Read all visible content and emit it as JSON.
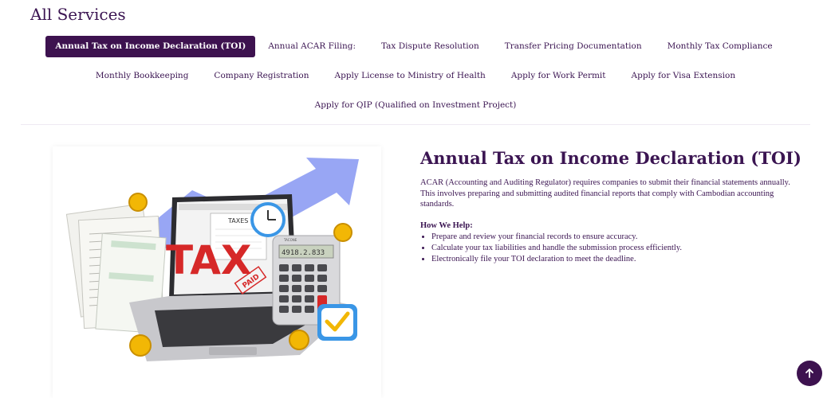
{
  "page": {
    "title": "All Services"
  },
  "tabs": {
    "row1": [
      {
        "label": "Annual Tax on Income Declaration (TOI)",
        "active": true
      },
      {
        "label": "Annual ACAR Filing:"
      },
      {
        "label": "Tax Dispute Resolution"
      },
      {
        "label": "Transfer Pricing Documentation"
      },
      {
        "label": "Monthly Tax Compliance"
      }
    ],
    "row2": [
      {
        "label": "Monthly Bookkeeping"
      },
      {
        "label": "Company Registration"
      },
      {
        "label": "Apply License to Ministry of Health"
      },
      {
        "label": "Apply for Work Permit"
      },
      {
        "label": "Apply for Visa Extension"
      }
    ],
    "row3": [
      {
        "label": "Apply for QIP (Qualified on Investment Project)"
      }
    ]
  },
  "illustration": {
    "tax_text": "TAX",
    "taxes_label": "TAXES",
    "paid_stamp": "PAID",
    "calculator_display": "4918.2.833",
    "calculator_brand": "TACONE"
  },
  "detail": {
    "title": "Annual Tax on Income Declaration (TOI)",
    "description": "ACAR (Accounting and Auditing Regulator) requires companies to submit their financial statements annually. This involves preparing and submitting audited financial reports that comply with Cambodian accounting standards.",
    "help_heading": "How We Help:",
    "help_items": [
      "Prepare and review your financial records to ensure accuracy.",
      "Calculate your tax liabilities and handle the submission process efficiently.",
      "Electronically file your TOI declaration to meet the deadline."
    ]
  },
  "colors": {
    "brand": "#3d124f",
    "text": "#3b1552"
  },
  "icons": {
    "scroll_top": "arrow-up-icon"
  }
}
